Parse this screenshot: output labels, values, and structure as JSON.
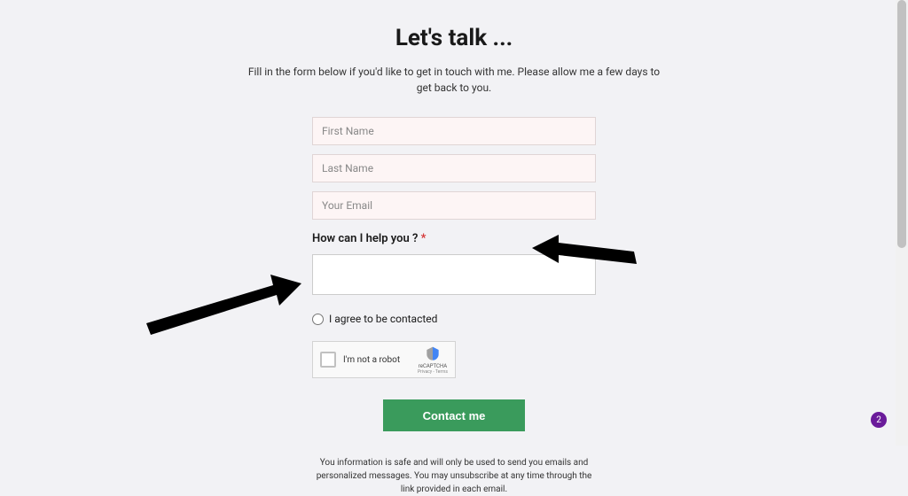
{
  "heading": "Let's talk ...",
  "subtitle": "Fill in the form below if you'd like to get in touch with me. Please allow me a few days to get back to you.",
  "form": {
    "first_name_placeholder": "First Name",
    "last_name_placeholder": "Last Name",
    "email_placeholder": "Your Email",
    "help_label": "How can I help you ?",
    "required_mark": "*",
    "consent_label": "I agree to be contacted",
    "recaptcha_text": "I'm not a robot",
    "recaptcha_brand": "reCAPTCHA",
    "recaptcha_terms": "Privacy - Terms",
    "submit_label": "Contact me"
  },
  "disclaimer": "You information is safe and will only be used to send you emails and personalized messages. You may unsubscribe at any time through the link provided in each email.",
  "badge_count": "2"
}
